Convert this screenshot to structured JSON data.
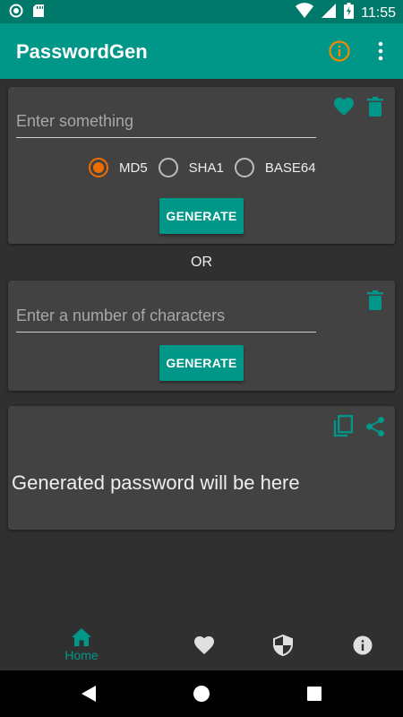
{
  "status_bar": {
    "time": "11:55"
  },
  "app_bar": {
    "title": "PasswordGen"
  },
  "hash_card": {
    "input_placeholder": "Enter something",
    "radios": [
      {
        "label": "MD5",
        "checked": true
      },
      {
        "label": "SHA1",
        "checked": false
      },
      {
        "label": "BASE64",
        "checked": false
      }
    ],
    "generate_label": "GENERATE"
  },
  "or_label": "OR",
  "random_card": {
    "input_placeholder": "Enter a number of characters",
    "generate_label": "GENERATE"
  },
  "output_card": {
    "text": "Generated password will be here"
  },
  "bottom_nav": {
    "items": [
      {
        "label": "Home",
        "icon": "home-icon",
        "active": true
      },
      {
        "label": "",
        "icon": "heart-icon",
        "active": false
      },
      {
        "label": "",
        "icon": "shield-icon",
        "active": false
      },
      {
        "label": "",
        "icon": "info-icon",
        "active": false
      }
    ]
  },
  "colors": {
    "primary": "#009688",
    "primary_dark": "#00796b",
    "accent": "#ef6c00",
    "background": "#303030",
    "card": "#424242"
  }
}
